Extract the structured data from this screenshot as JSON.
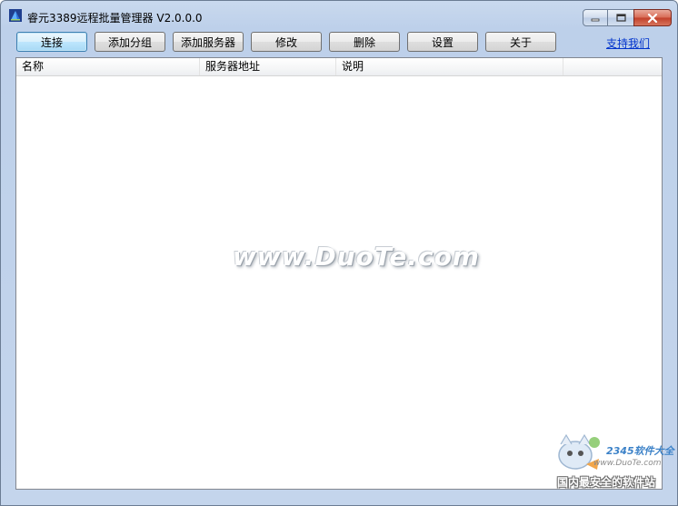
{
  "window": {
    "title": "睿元3389远程批量管理器 V2.0.0.0",
    "controls": {
      "minimize_icon": "minimize-icon",
      "maximize_icon": "restore-icon",
      "close_icon": "close-icon"
    }
  },
  "toolbar": {
    "buttons": [
      {
        "label": "连接"
      },
      {
        "label": "添加分组"
      },
      {
        "label": "添加服务器"
      },
      {
        "label": "修改"
      },
      {
        "label": "删除"
      },
      {
        "label": "设置"
      },
      {
        "label": "关于"
      }
    ],
    "support_link": "支持我们"
  },
  "list": {
    "columns": [
      "名称",
      "服务器地址",
      "说明"
    ],
    "rows": []
  },
  "watermarks": {
    "center": "www.DuoTe.com",
    "stamp_brand": "2345软件大全",
    "stamp_url": "www.DuoTe.com",
    "stamp_slogan": "国内最安全的软件站"
  },
  "colors": {
    "titlebar": "#bdd0ea",
    "primary_button_border": "#3c7fb1",
    "link": "#0033cc",
    "close_button": "#c2402a"
  }
}
